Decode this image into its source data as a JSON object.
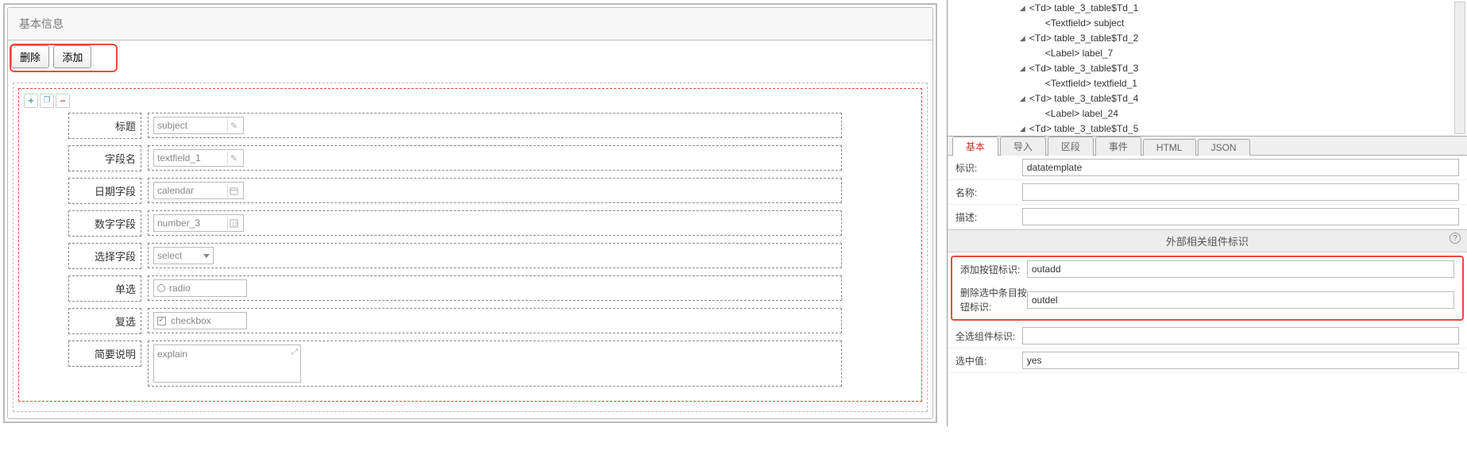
{
  "fieldset": {
    "title": "基本信息"
  },
  "buttons": {
    "delete": "删除",
    "add": "添加"
  },
  "form": {
    "rows": [
      {
        "label": "标题",
        "value": "subject",
        "type": "text-suffix"
      },
      {
        "label": "字段名",
        "value": "textfield_1",
        "type": "text-suffix"
      },
      {
        "label": "日期字段",
        "value": "calendar",
        "type": "date"
      },
      {
        "label": "数字字段",
        "value": "number_3",
        "type": "number"
      },
      {
        "label": "选择字段",
        "value": "select",
        "type": "select"
      },
      {
        "label": "单选",
        "value": "radio",
        "type": "radio"
      },
      {
        "label": "复选",
        "value": "checkbox",
        "type": "checkbox"
      },
      {
        "label": "简要说明",
        "value": "explain",
        "type": "textarea"
      }
    ]
  },
  "tree": {
    "nodes": [
      {
        "indent": 1,
        "text": "<Td>  table_3_table$Td_1",
        "toggle": true
      },
      {
        "indent": 2,
        "text": "<Textfield>  subject",
        "toggle": false
      },
      {
        "indent": 1,
        "text": "<Td>  table_3_table$Td_2",
        "toggle": true
      },
      {
        "indent": 2,
        "text": "<Label>  label_7",
        "toggle": false
      },
      {
        "indent": 1,
        "text": "<Td>  table_3_table$Td_3",
        "toggle": true
      },
      {
        "indent": 2,
        "text": "<Textfield>  textfield_1",
        "toggle": false
      },
      {
        "indent": 1,
        "text": "<Td>  table_3_table$Td_4",
        "toggle": true
      },
      {
        "indent": 2,
        "text": "<Label>  label_24",
        "toggle": false
      },
      {
        "indent": 1,
        "text": "<Td>  table_3_table$Td_5",
        "toggle": true
      }
    ]
  },
  "tabs": {
    "items": [
      "基本",
      "导入",
      "区段",
      "事件",
      "HTML",
      "JSON"
    ],
    "active": 0
  },
  "props": {
    "id_label": "标识:",
    "id_value": "datatemplate",
    "name_label": "名称:",
    "name_value": "",
    "desc_label": "描述:",
    "desc_value": "",
    "section": "外部相关组件标识",
    "add_label": "添加按钮标识:",
    "add_value": "outadd",
    "del_label": "删除选中条目按钮标识:",
    "del_value": "outdel",
    "selectall_label": "全选组件标识:",
    "selectall_value": "",
    "selval_label": "选中值:",
    "selval_value": "yes"
  }
}
